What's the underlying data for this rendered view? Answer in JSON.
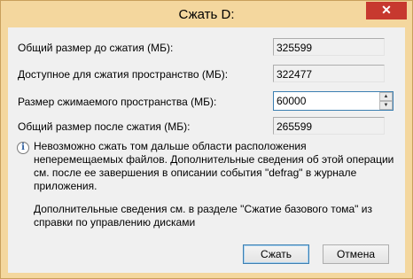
{
  "window": {
    "title": "Сжать D:",
    "close_glyph": "✕"
  },
  "fields": {
    "total_before_label": "Общий размер до сжатия (МБ):",
    "total_before_value": "325599",
    "available_label": "Доступное для сжатия пространство (МБ):",
    "available_value": "322477",
    "shrink_label": "Размер сжимаемого пространства (МБ):",
    "shrink_value": "60000",
    "total_after_label": "Общий размер после сжатия (МБ):",
    "total_after_value": "265599"
  },
  "info": {
    "icon_glyph": "i",
    "text": "Невозможно сжать том дальше области расположения неперемещаемых файлов. Дополнительные сведения об этой операции см. после ее завершения в описании события \"defrag\" в журнале приложения.",
    "more": "Дополнительные сведения см. в разделе \"Сжатие базового тома\" из справки по управлению дисками"
  },
  "buttons": {
    "shrink": "Сжать",
    "cancel": "Отмена"
  }
}
